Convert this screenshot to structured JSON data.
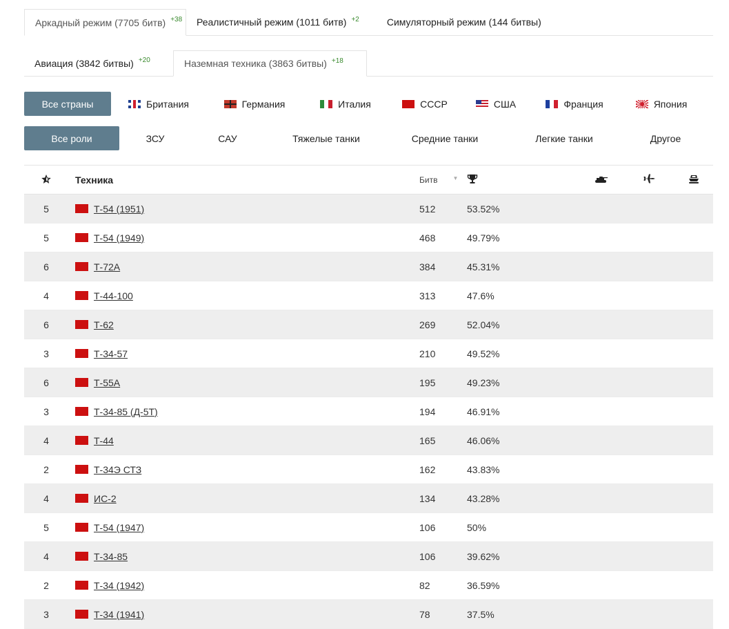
{
  "mode_tabs": [
    {
      "label": "Аркадный режим (7705 битв)",
      "delta": "+38"
    },
    {
      "label": "Реалистичный режим (1011 битв)",
      "delta": "+2"
    },
    {
      "label": "Симуляторный режим (144 битвы)",
      "delta": ""
    }
  ],
  "type_tabs": [
    {
      "label": "Авиация (3842 битвы)",
      "delta": "+20"
    },
    {
      "label": "Наземная техника (3863 битвы)",
      "delta": "+18"
    }
  ],
  "countries": {
    "all": "Все страны",
    "items": [
      {
        "label": "Британия",
        "icon": "uk-flag-icon"
      },
      {
        "label": "Германия",
        "icon": "germany-flag-icon"
      },
      {
        "label": "Италия",
        "icon": "italy-flag-icon"
      },
      {
        "label": "СССР",
        "icon": "ussr-flag-icon"
      },
      {
        "label": "США",
        "icon": "usa-flag-icon"
      },
      {
        "label": "Франция",
        "icon": "france-flag-icon"
      },
      {
        "label": "Япония",
        "icon": "japan-flag-icon"
      }
    ]
  },
  "roles": {
    "all": "Все роли",
    "items": [
      "ЗСУ",
      "САУ",
      "Тяжелые танки",
      "Средние танки",
      "Легкие танки",
      "Другое"
    ]
  },
  "table": {
    "headers": {
      "rank_icon": "star-icon",
      "name": "Техника",
      "battles": "Битв",
      "win_icon": "trophy-icon",
      "tank_icon": "tank-icon",
      "plane_icon": "plane-icon",
      "ship_icon": "ship-icon"
    },
    "rows": [
      {
        "rank": "5",
        "name": "Т-54 (1951)",
        "battles": "512",
        "winrate": "53.52%"
      },
      {
        "rank": "5",
        "name": "Т-54 (1949)",
        "battles": "468",
        "winrate": "49.79%"
      },
      {
        "rank": "6",
        "name": "Т-72А",
        "battles": "384",
        "winrate": "45.31%"
      },
      {
        "rank": "4",
        "name": "Т-44-100",
        "battles": "313",
        "winrate": "47.6%"
      },
      {
        "rank": "6",
        "name": "Т-62",
        "battles": "269",
        "winrate": "52.04%"
      },
      {
        "rank": "3",
        "name": "Т-34-57",
        "battles": "210",
        "winrate": "49.52%"
      },
      {
        "rank": "6",
        "name": "Т-55А",
        "battles": "195",
        "winrate": "49.23%"
      },
      {
        "rank": "3",
        "name": "Т-34-85 (Д-5Т)",
        "battles": "194",
        "winrate": "46.91%"
      },
      {
        "rank": "4",
        "name": "Т-44",
        "battles": "165",
        "winrate": "46.06%"
      },
      {
        "rank": "2",
        "name": "Т-34Э СТЗ",
        "battles": "162",
        "winrate": "43.83%"
      },
      {
        "rank": "4",
        "name": "ИС-2",
        "battles": "134",
        "winrate": "43.28%"
      },
      {
        "rank": "5",
        "name": "Т-54 (1947)",
        "battles": "106",
        "winrate": "50%"
      },
      {
        "rank": "4",
        "name": "Т-34-85",
        "battles": "106",
        "winrate": "39.62%"
      },
      {
        "rank": "2",
        "name": "Т-34 (1942)",
        "battles": "82",
        "winrate": "36.59%"
      },
      {
        "rank": "3",
        "name": "Т-34 (1941)",
        "battles": "78",
        "winrate": "37.5%"
      }
    ]
  },
  "colors": {
    "accent": "#5f7d8e",
    "delta": "#3a8a2e",
    "row_alt": "#eeeeee",
    "ussr_flag": "#cc1010"
  }
}
